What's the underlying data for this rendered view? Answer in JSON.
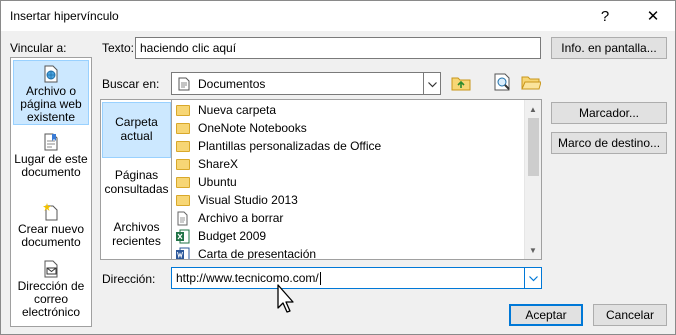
{
  "window": {
    "title": "Insertar hipervínculo",
    "help_glyph": "?",
    "close_glyph": "✕"
  },
  "link_to": {
    "label": "Vincular a:",
    "items": [
      {
        "label": "Archivo o página web existente",
        "icon": "web-page-icon",
        "selected": true
      },
      {
        "label": "Lugar de este documento",
        "icon": "document-place-icon",
        "selected": false
      },
      {
        "label": "Crear nuevo documento",
        "icon": "new-document-icon",
        "selected": false
      },
      {
        "label": "Dirección de correo electrónico",
        "icon": "email-icon",
        "selected": false
      }
    ]
  },
  "text_to_display": {
    "label": "Texto:",
    "value": "haciendo clic aquí"
  },
  "screen_tip_button": "Info. en pantalla...",
  "look_in": {
    "label": "Buscar en:",
    "value": "Documentos"
  },
  "browse": {
    "items": [
      {
        "label": "Carpeta actual",
        "selected": true
      },
      {
        "label": "Páginas consultadas",
        "selected": false
      },
      {
        "label": "Archivos recientes",
        "selected": false
      }
    ]
  },
  "files": [
    {
      "name": "Nueva carpeta",
      "type": "folder"
    },
    {
      "name": "OneNote Notebooks",
      "type": "folder"
    },
    {
      "name": "Plantillas personalizadas de Office",
      "type": "folder"
    },
    {
      "name": "ShareX",
      "type": "folder"
    },
    {
      "name": "Ubuntu",
      "type": "folder"
    },
    {
      "name": "Visual Studio 2013",
      "type": "folder"
    },
    {
      "name": "Archivo a borrar",
      "type": "text"
    },
    {
      "name": "Budget 2009",
      "type": "excel"
    },
    {
      "name": "Carta de presentación",
      "type": "word"
    }
  ],
  "bookmark_button": "Marcador...",
  "target_frame_button": "Marco de destino...",
  "address": {
    "label": "Dirección:",
    "value": "http://www.tecnicomo.com/"
  },
  "ok_button": "Aceptar",
  "cancel_button": "Cancelar",
  "colors": {
    "selection": "#cce8ff",
    "accent": "#0078d7",
    "folder": "#f7d675"
  }
}
